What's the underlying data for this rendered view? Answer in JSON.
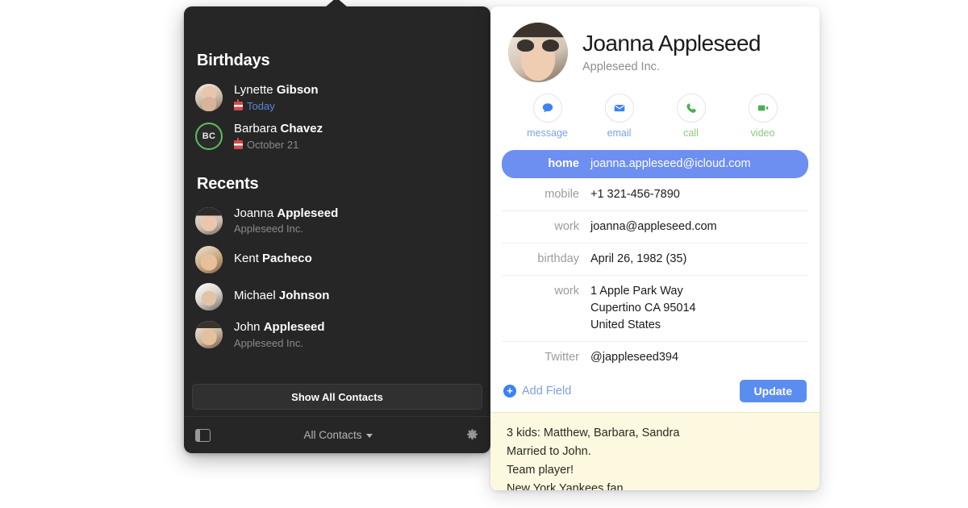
{
  "popover": {
    "sections": [
      {
        "title": "Birthdays",
        "items": [
          {
            "first": "Lynette ",
            "last": "Gibson",
            "birthday": "Today",
            "is_today": true,
            "avatar_kind": "photo",
            "avatar_style": "ph-lynette",
            "initials": ""
          },
          {
            "first": "Barbara ",
            "last": "Chavez",
            "birthday": "October 21",
            "is_today": false,
            "avatar_kind": "monogram",
            "avatar_style": "",
            "initials": "BC"
          }
        ]
      },
      {
        "title": "Recents",
        "items": [
          {
            "first": "Joanna ",
            "last": "Appleseed",
            "company": "Appleseed Inc.",
            "avatar_kind": "photo",
            "avatar_style": "ph-joanna",
            "initials": ""
          },
          {
            "first": "Kent ",
            "last": "Pacheco",
            "company": "",
            "avatar_kind": "photo",
            "avatar_style": "ph-kent",
            "initials": ""
          },
          {
            "first": "Michael ",
            "last": "Johnson",
            "company": "",
            "avatar_kind": "photo",
            "avatar_style": "ph-michael",
            "initials": ""
          },
          {
            "first": "John ",
            "last": "Appleseed",
            "company": "Appleseed Inc.",
            "avatar_kind": "photo",
            "avatar_style": "ph-john",
            "initials": ""
          }
        ]
      }
    ],
    "show_all_label": "Show All Contacts",
    "group_selector_label": "All Contacts",
    "sidebar_toggle_icon": "sidebar-toggle-icon",
    "gear_icon": "gear-icon",
    "chevron_icon": "chevron-down-icon",
    "background_color": "#262626"
  },
  "card": {
    "name": "Joanna Appleseed",
    "company": "Appleseed Inc.",
    "avatar_icon": "contact-photo",
    "actions": [
      {
        "label": "message",
        "icon": "message-bubble-icon",
        "color": "#4a90e8",
        "tone": "blue"
      },
      {
        "label": "email",
        "icon": "envelope-icon",
        "color": "#4a90e8",
        "tone": "blue"
      },
      {
        "label": "call",
        "icon": "phone-icon",
        "color": "#5cb85c",
        "tone": "green"
      },
      {
        "label": "video",
        "icon": "video-camera-icon",
        "color": "#5cb85c",
        "tone": "green"
      }
    ],
    "fields": [
      {
        "label": "home",
        "value": "joanna.appleseed@icloud.com",
        "highlighted": true
      },
      {
        "label": "mobile",
        "value": "+1 321-456-7890",
        "highlighted": false
      },
      {
        "label": "work",
        "value": "joanna@appleseed.com",
        "highlighted": false
      },
      {
        "label": "birthday",
        "value": "April 26, 1982  (35)",
        "highlighted": false
      },
      {
        "label": "work",
        "value": "",
        "highlighted": false,
        "lines": [
          "1 Apple Park Way",
          "Cupertino  CA  95014",
          "United States"
        ]
      },
      {
        "label": "Twitter",
        "value": "@jappleseed394",
        "highlighted": false
      }
    ],
    "add_field_label": "Add Field",
    "add_field_icon": "plus-circle-icon",
    "update_label": "Update",
    "highlight_color": "#6d8ff2",
    "update_color": "#5b8df0",
    "notes": [
      "3 kids: Matthew, Barbara, Sandra",
      "Married to John.",
      "Team player!",
      "New York Yankees fan."
    ],
    "notes_background": "#fdf8e0"
  }
}
